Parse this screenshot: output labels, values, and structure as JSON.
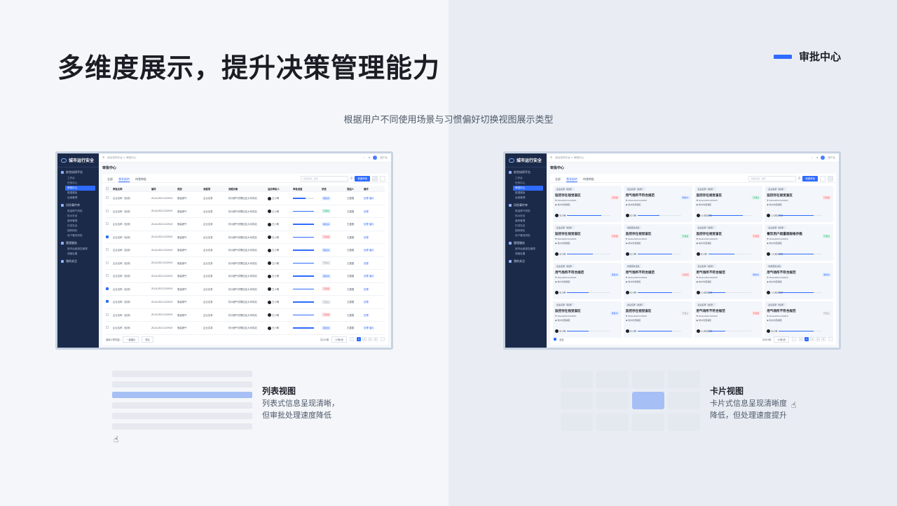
{
  "headline": "多维度展示，提升决策管理能力",
  "tag": "审批中心",
  "subtitle": "根据用户不同使用场景与习惯偏好切换视图展示类型",
  "app": {
    "logo": "城市运行安全",
    "breadcrumb": "综合协同平台 > 审批中心",
    "user": "用户名",
    "page_title": "审批中心",
    "sidebar": [
      {
        "section": "综合协同平台",
        "items": [
          "工作台",
          "任务中心",
          "审批中心",
          "数据看板",
          "运维管理"
        ]
      },
      {
        "section": "风险事件库",
        "items": [
          "燃油燃气风险",
          "供水安全",
          "道桥管理",
          "内涝安全",
          "园林绿化",
          "地下管线风险"
        ]
      },
      {
        "section": "管理服务",
        "items": [
          "城市运营报告管理",
          "调度处置"
        ]
      },
      {
        "section": "我的关注",
        "items": []
      }
    ],
    "active_item": "审批中心",
    "tabs": [
      "全部",
      "我发起的",
      "待我审批"
    ],
    "active_tab": "我发起的",
    "search_placeholder": "搜索标题、编号",
    "new_button": "新建审批"
  },
  "list_view": {
    "headers": [
      "审批名称",
      "编号",
      "类别",
      "流程项",
      "流程对象",
      "当前审批人",
      "审批进度",
      "状态",
      "发起人",
      "操作"
    ],
    "rows": [
      {
        "name": "企业名称（检测）",
        "code": "ZLGL2021120915",
        "type": "瓶装燃气",
        "flow": "企业名录",
        "obj": "杭州燃气供需应区大本供站",
        "approver": "王小明",
        "progress": 0.6,
        "status": "审批中",
        "status_kind": "blue",
        "initiator": "王建国",
        "ops": "处理 催办",
        "checked": false
      },
      {
        "name": "企业名称（检测）",
        "code": "ZLGL2021120915",
        "type": "瓶装燃气",
        "flow": "企业名录",
        "obj": "杭州燃气供需应区大本供站",
        "approver": "王小明",
        "progress": 1.0,
        "status": "已通过",
        "status_kind": "green",
        "initiator": "王建国",
        "ops": "处理",
        "checked": false
      },
      {
        "name": "企业名称（检测）",
        "code": "ZLGL2021120915",
        "type": "瓶装燃气",
        "flow": "企业名录",
        "obj": "杭州燃气供需应区大本供站",
        "approver": "王小明",
        "progress": 1.0,
        "status": "审批中",
        "status_kind": "blue",
        "initiator": "王建国",
        "ops": "处理 催办",
        "checked": false
      },
      {
        "name": "企业名称（检测）",
        "code": "ZLGL2021120915",
        "type": "瓶装燃气",
        "flow": "企业名录",
        "obj": "杭州燃气供需应区大本供站",
        "approver": "王小明",
        "progress": 1.0,
        "status": "已驳回",
        "status_kind": "red",
        "initiator": "王建国",
        "ops": "处理",
        "checked": true
      },
      {
        "name": "企业名称（检测）",
        "code": "ZLGL2021120915",
        "type": "瓶装燃气",
        "flow": "企业名录",
        "obj": "杭州燃气供需应区大本供站",
        "approver": "王小明",
        "progress": 1.0,
        "status": "审批中",
        "status_kind": "blue",
        "initiator": "王建国",
        "ops": "处理 催办",
        "checked": false
      },
      {
        "name": "企业名称（检测）",
        "code": "ZLGL2021120915",
        "type": "瓶装燃气",
        "flow": "企业名录",
        "obj": "杭州燃气供需应区大本供站",
        "approver": "王小明",
        "progress": 1.0,
        "status": "已终止",
        "status_kind": "gray",
        "initiator": "王建国",
        "ops": "处理",
        "checked": false
      },
      {
        "name": "企业名称（检测）",
        "code": "ZLGL2021120915",
        "type": "瓶装燃气",
        "flow": "企业名录",
        "obj": "杭州燃气供需应区大本供站",
        "approver": "王小明",
        "progress": 1.0,
        "status": "审批中",
        "status_kind": "blue",
        "initiator": "王建国",
        "ops": "处理 催办",
        "checked": false
      },
      {
        "name": "企业名称（检测）",
        "code": "ZLGL2021120915",
        "type": "瓶装燃气",
        "flow": "企业名录",
        "obj": "杭州燃气供需应区大本供站",
        "approver": "王小明",
        "progress": 1.0,
        "status": "已驳回",
        "status_kind": "red",
        "initiator": "王建国",
        "ops": "处理",
        "checked": true
      },
      {
        "name": "企业名称（检测）",
        "code": "ZLGL2021120915",
        "type": "瓶装燃气",
        "flow": "企业名录",
        "obj": "杭州燃气供需应区大本供站",
        "approver": "王小明",
        "progress": 1.0,
        "status": "已终止",
        "status_kind": "gray",
        "initiator": "王建国",
        "ops": "处理",
        "checked": true
      },
      {
        "name": "企业名称（检测）",
        "code": "ZLGL2021120915",
        "type": "瓶装燃气",
        "flow": "企业名录",
        "obj": "杭州燃气供需应区大本供站",
        "approver": "王小明",
        "progress": 1.0,
        "status": "已驳回",
        "status_kind": "red",
        "initiator": "王建国",
        "ops": "处理",
        "checked": false
      },
      {
        "name": "企业名称（检测）",
        "code": "ZLGL2021120915",
        "type": "瓶装燃气",
        "flow": "企业名录",
        "obj": "杭州燃气供需应区大本供站",
        "approver": "王小明",
        "progress": 1.0,
        "status": "审批中",
        "status_kind": "blue",
        "initiator": "王建国",
        "ops": "处理 催办",
        "checked": false
      }
    ],
    "footer_selected": "选择(1项内容)",
    "footer_btn1": "一键催办",
    "footer_btn2": "导出",
    "total": "共123条",
    "page_size": "10条/页",
    "pages": [
      "1",
      "2",
      "3",
      "4"
    ],
    "current_page": "1",
    "label": "列表视图",
    "desc1": "列表式信息呈现清晰，",
    "desc2": "但审批处理速度降低"
  },
  "card_view": {
    "cards": [
      {
        "org": "企业名录（检测）",
        "title": "监控存在视觉盲区",
        "status": "已驳回",
        "kind": "red",
        "code": "ZLGL2021120915",
        "area": "杭州市西湖区",
        "who": "王小明",
        "progress": 0.8
      },
      {
        "org": "企业名录（检测）",
        "title": "用气场所不符合规范",
        "status": "审批中",
        "kind": "blue",
        "code": "ZLGL2021120915",
        "area": "杭州市西湖区",
        "who": "王小明",
        "progress": 0.5
      },
      {
        "org": "企业名录（检测）",
        "title": "监控存在视觉盲区",
        "status": "已通过",
        "kind": "green",
        "code": "ZLGL2021120915",
        "area": "杭州市西湖区",
        "who": "3人通过审批",
        "progress": 0.8
      },
      {
        "org": "企业名录（检测）",
        "title": "监控存在视觉盲区",
        "status": "已驳回",
        "kind": "red",
        "code": "ZLGL2021120915",
        "area": "杭州市西湖区",
        "who": "1人通过审批",
        "progress": 0.8
      },
      {
        "org": "企业名录（检测）",
        "title": "监控存在视觉盲区",
        "status": "已驳回",
        "kind": "red",
        "code": "ZLGL2021120915",
        "area": "杭州市西湖区",
        "who": "王小明",
        "progress": 0.6
      },
      {
        "org": "市级查执法队",
        "title": "监控存在视觉盲区",
        "status": "已通过",
        "kind": "green",
        "code": "ZLGL2021120915",
        "area": "杭州市西湖区",
        "who": "王小明",
        "progress": 0.8
      },
      {
        "org": "企业名录（检测）",
        "title": "监控存在视觉盲区",
        "status": "已驳回",
        "kind": "red",
        "code": "ZLGL2021120915",
        "area": "杭州市西湖区",
        "who": "王小明",
        "progress": 0.6
      },
      {
        "org": "企业名录（检测）",
        "title": "餐饮用户超量超规格存瓶",
        "status": "已通过",
        "kind": "green",
        "code": "ZLGL2021120915",
        "area": "杭州市西湖区",
        "who": "1人通过审批",
        "progress": 0.8
      },
      {
        "org": "企业名录（检测）",
        "title": "用气场所不符合规范",
        "status": "审批中",
        "kind": "blue",
        "code": "ZLGL2021120915",
        "area": "杭州市西湖区",
        "who": "王小明",
        "progress": 0.5
      },
      {
        "org": "市级查执法队",
        "title": "用气场所不符合规范",
        "status": "已驳回",
        "kind": "red",
        "code": "ZLGL2021120915",
        "area": "杭州市西湖区",
        "who": "王小明",
        "progress": 0.8
      },
      {
        "org": "企业名录（检测）",
        "title": "用气场所不符合规范",
        "status": "审批中",
        "kind": "blue",
        "code": "ZLGL2021120915",
        "area": "杭州市西湖区",
        "who": "1人通过审批",
        "progress": 0.4
      },
      {
        "org": "市级查执法队",
        "title": "用气场所不符合规范",
        "status": "审批中",
        "kind": "blue",
        "code": "ZLGL2021120915",
        "area": "杭州市西湖区",
        "who": "1人通过审批",
        "progress": 0.8
      },
      {
        "org": "企业名录（检测）",
        "title": "监控存在视觉盲区",
        "status": "审批中",
        "kind": "blue",
        "code": "ZLGL2021120915",
        "area": "杭州市西湖区",
        "who": "王小明",
        "progress": 0.5
      },
      {
        "org": "企业名录（检测）",
        "title": "监控存在视觉盲区",
        "status": "已终止",
        "kind": "gray",
        "code": "ZLGL2021120915",
        "area": "杭州市西湖区",
        "who": "王小明",
        "progress": 0.8
      },
      {
        "org": "企业名录（检测）",
        "title": "用气场所不符合规范",
        "status": "已驳回",
        "kind": "red",
        "code": "ZLGL2021120915",
        "area": "杭州市西湖区",
        "who": "1人通过审批",
        "progress": 0.4
      },
      {
        "org": "企业名录（检测）",
        "title": "用气场所不符合规范",
        "status": "已终止",
        "kind": "gray",
        "code": "ZLGL2021120915",
        "area": "杭州市西湖区",
        "who": "王小明",
        "progress": 0.8
      }
    ],
    "select_all": "全选",
    "total": "共453条",
    "page_size": "10条/页",
    "pages": [
      "1",
      "2",
      "3",
      "4",
      "5"
    ],
    "current_page": "2",
    "label": "卡片视图",
    "desc1": "卡片式信息呈现清晰度",
    "desc2": "降低，但处理速度提升"
  },
  "colors": {
    "accent": "#2f6bff",
    "sidebar": "#1c2a4a",
    "highlight": "#a6bff5"
  }
}
